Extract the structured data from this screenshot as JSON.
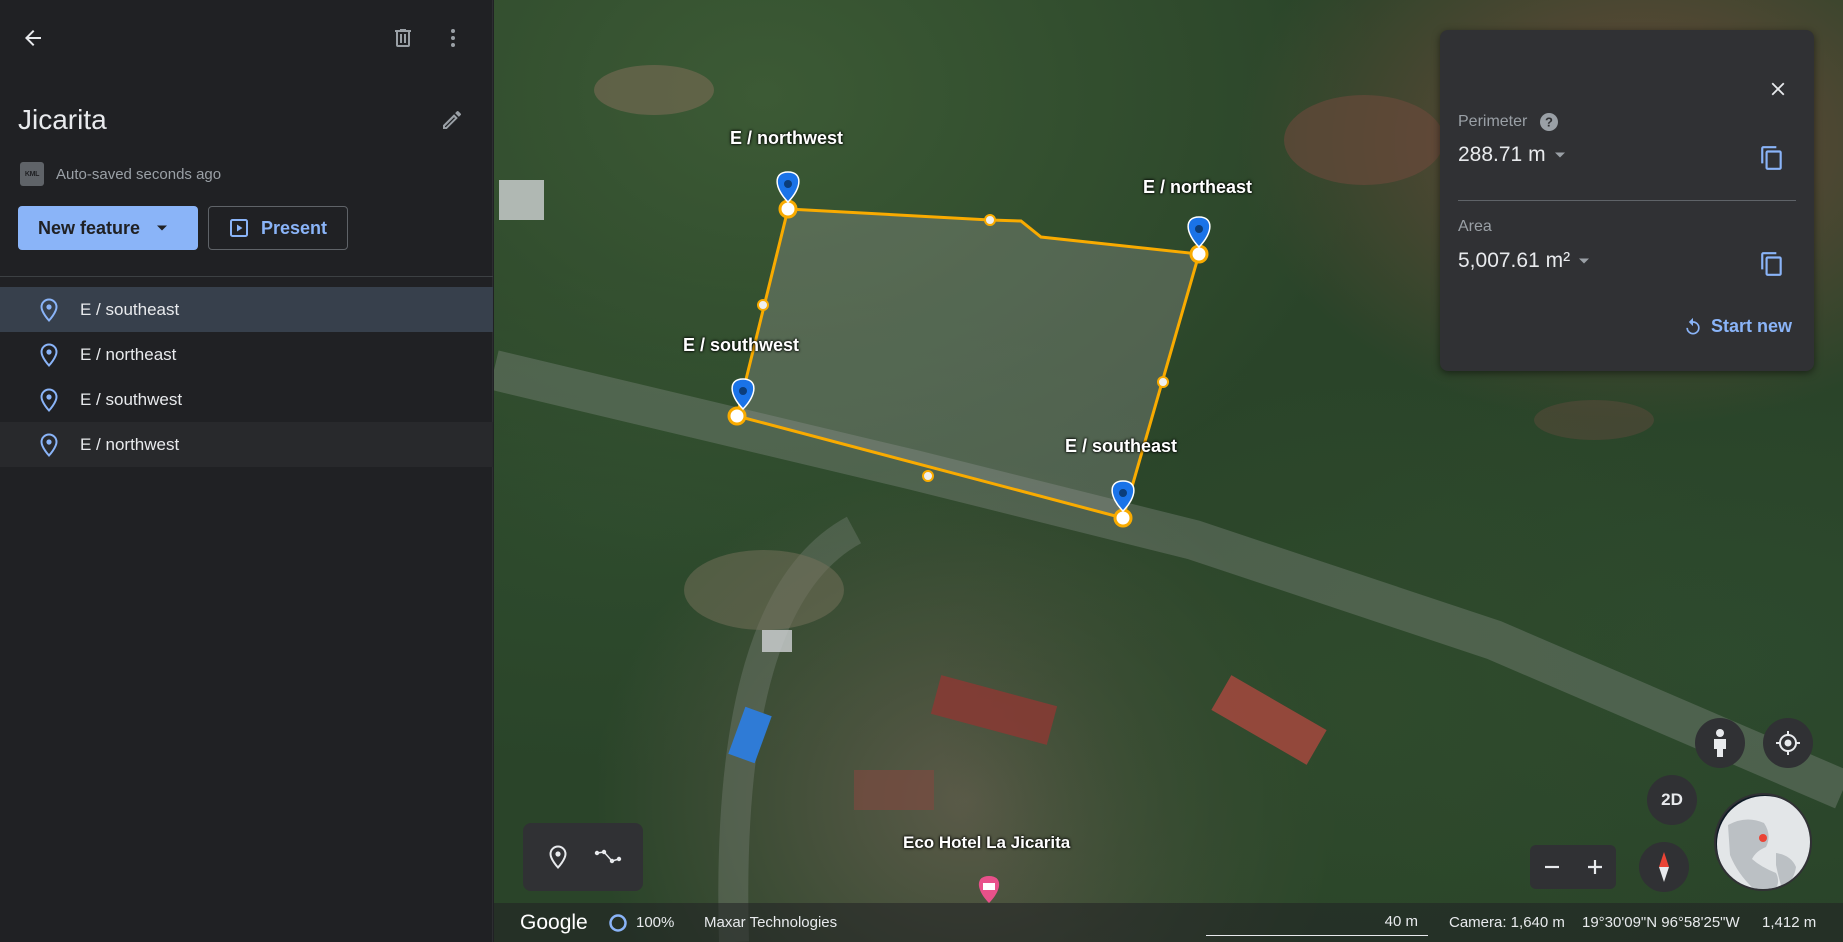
{
  "sidebar": {
    "title": "Jicarita",
    "autosave_badge": "KML",
    "autosave_text": "Auto-saved seconds ago",
    "new_feature_label": "New feature",
    "present_label": "Present",
    "features": [
      {
        "label": "E / southeast",
        "state": "selected"
      },
      {
        "label": "E / northeast",
        "state": "normal"
      },
      {
        "label": "E / southwest",
        "state": "normal"
      },
      {
        "label": "E / northwest",
        "state": "hover"
      }
    ]
  },
  "map": {
    "labels": {
      "northwest": "E / northwest",
      "northeast": "E / northeast",
      "southwest": "E / southwest",
      "southeast": "E / southeast",
      "poi": "Eco Hotel La Jicarita"
    },
    "polygon_color": "#f9ab00",
    "pin_color": "#1a73e8",
    "view_mode": "2D"
  },
  "measure": {
    "perimeter_label": "Perimeter",
    "perimeter_value": "288.71 m",
    "area_label": "Area",
    "area_value": "5,007.61 m²",
    "start_new_label": "Start new"
  },
  "status": {
    "logo": "Google",
    "load_percent": "100%",
    "attribution": "Maxar Technologies",
    "scale": "40 m",
    "camera": "Camera: 1,640 m",
    "coordinates": "19°30'09\"N 96°58'25\"W",
    "elevation": "1,412 m"
  },
  "colors": {
    "accent": "#8ab4f8",
    "panel": "#303134",
    "sidebar": "#202124"
  }
}
